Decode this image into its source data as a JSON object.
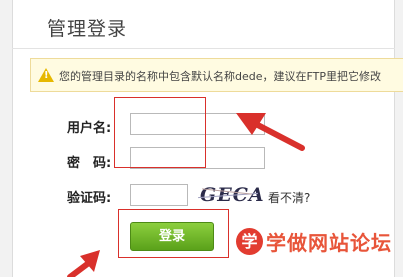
{
  "page": {
    "title": "管理登录"
  },
  "alert": {
    "icon": "warning-icon",
    "text": "您的管理目录的名称中包含默认名称dede，建议在FTP里把它修改"
  },
  "form": {
    "username_label": "用户名:",
    "username_value": "",
    "password_label": "密　码:",
    "password_value": "",
    "captcha_label": "验证码:",
    "captcha_value": "",
    "captcha_image_text": "GECA",
    "unclear_link": "看不清?",
    "login_button": "登录"
  },
  "watermark": {
    "logo_char": "学",
    "text": "学做网站论坛"
  },
  "colors": {
    "annotation": "#d9302b",
    "login_button": "#6cb52a",
    "alert_background": "#fffbe1",
    "watermark": "#e8553a"
  }
}
